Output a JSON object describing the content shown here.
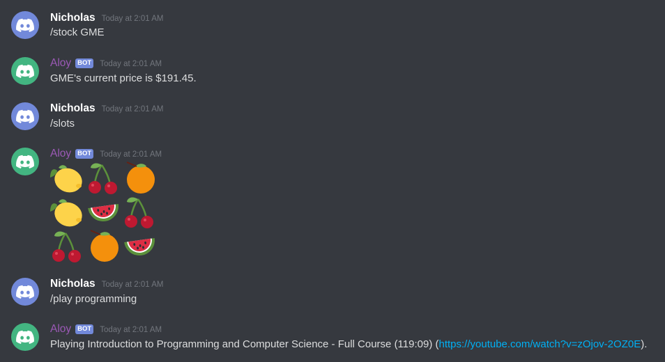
{
  "colors": {
    "background": "#36393f",
    "username": "#ffffff",
    "bot_username": "#9b59b6",
    "bot_tag": "#7289da",
    "timestamp": "#72767d",
    "text": "#dcddde",
    "link": "#00b0f4",
    "user_avatar": "#7289da",
    "bot_avatar": "#43b581"
  },
  "messages": [
    {
      "author": "Nicholas",
      "time": "Today at 2:01 AM",
      "text": "/stock GME"
    },
    {
      "author": "Aloy",
      "bot_tag": "BOT",
      "time": "Today at 2:01 AM",
      "text": "GME's current price is $191.45."
    },
    {
      "author": "Nicholas",
      "time": "Today at 2:01 AM",
      "text": "/slots"
    },
    {
      "author": "Aloy",
      "bot_tag": "BOT",
      "time": "Today at 2:01 AM",
      "slots": [
        "lemon",
        "cherries",
        "orange",
        "lemon",
        "watermelon",
        "cherries",
        "cherries",
        "orange",
        "watermelon"
      ]
    },
    {
      "author": "Nicholas",
      "time": "Today at 2:01 AM",
      "text": "/play programming"
    },
    {
      "author": "Aloy",
      "bot_tag": "BOT",
      "time": "Today at 2:01 AM",
      "text_before": "Playing Introduction to Programming and Computer Science - Full Course (119:09) (",
      "link": "https://youtube.com/watch?v=zOjov-2OZ0E",
      "text_after": ")."
    }
  ]
}
